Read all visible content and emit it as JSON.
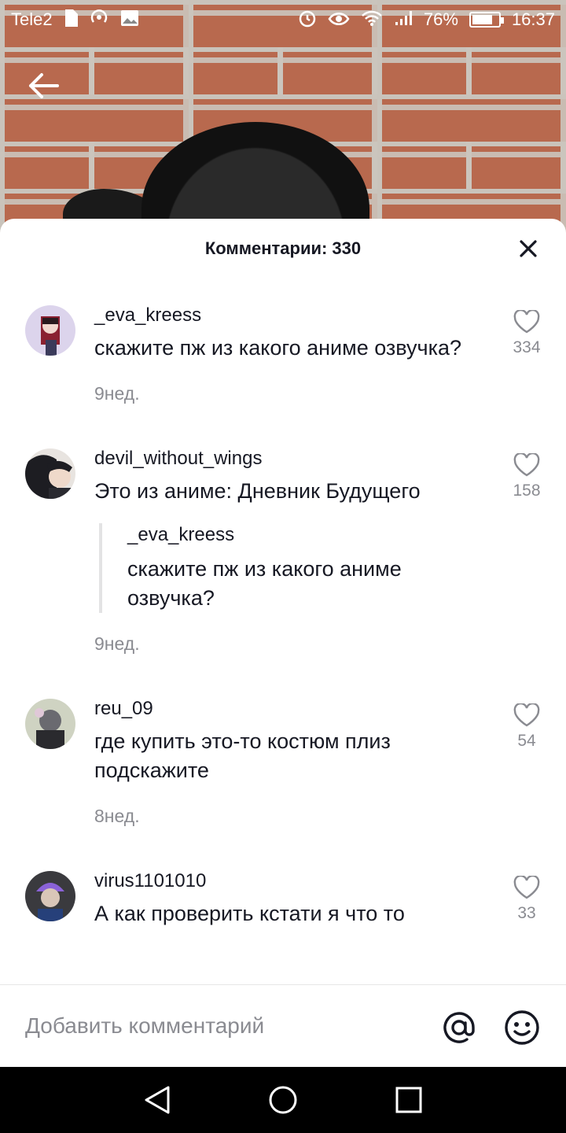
{
  "status_bar": {
    "carrier": "Tele2",
    "battery_percent": "76%",
    "time": "16:37"
  },
  "sheet": {
    "title": "Комментарии: 330"
  },
  "comments": [
    {
      "username": "_eva_kreess",
      "text": "скажите пж из какого аниме озвучка?",
      "time": "9нед.",
      "likes": "334"
    },
    {
      "username": "devil_without_wings",
      "text": "Это из аниме: Дневник Будущего",
      "reply_to": {
        "username": "_eva_kreess",
        "text": "скажите пж из какого аниме озвучка?"
      },
      "time": "9нед.",
      "likes": "158"
    },
    {
      "username": "reu_09",
      "text": "где купить это-то костюм плиз подскажите",
      "time": "8нед.",
      "likes": "54"
    },
    {
      "username": "virus1101010",
      "text": "А как проверить кстати я что то",
      "likes": "33"
    }
  ],
  "input": {
    "placeholder": "Добавить комментарий"
  },
  "colors": {
    "text_primary": "#161823",
    "text_secondary": "#8a8b91"
  }
}
